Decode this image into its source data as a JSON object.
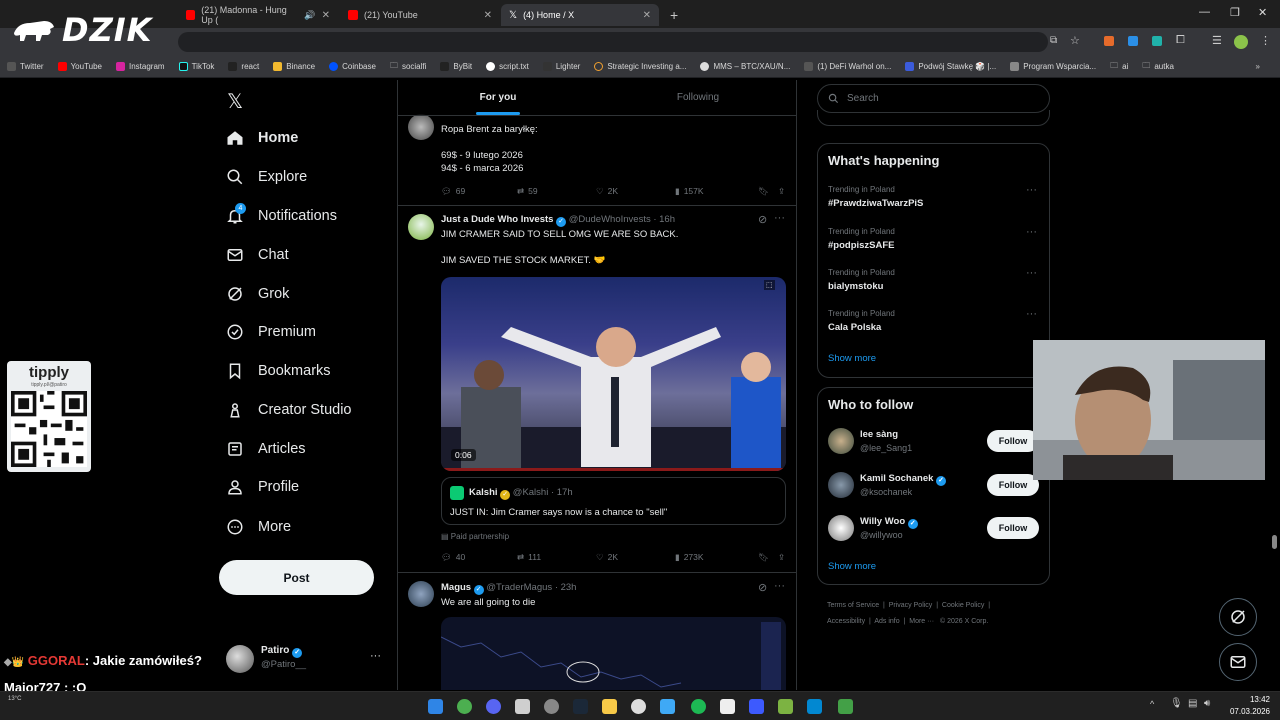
{
  "browser": {
    "tabs": [
      {
        "label": "(21) Madonna - Hung Up (",
        "icon": "youtube-icon",
        "color": "#ff0000"
      },
      {
        "label": "(21) YouTube",
        "icon": "youtube-icon",
        "color": "#ff0000"
      },
      {
        "label": "(4) Home / X",
        "icon": "x-icon",
        "color": "#ffffff",
        "active": true
      }
    ],
    "new_tab": "+",
    "bookmarks": [
      "Twitter",
      "YouTube",
      "Instagram",
      "TikTok",
      "react",
      "Binance",
      "Coinbase",
      "socialfi",
      "ByBit",
      "script.txt",
      "Lighter",
      "Strategic Investing a...",
      "MMS – BTC/XAU/N...",
      "(1) DeFi Warhol on...",
      "Podwój Stawkę 🎲 |...",
      "Program Wsparcia...",
      "ai",
      "autka"
    ]
  },
  "overlay": {
    "logo_text": "DZIK",
    "tipply_title": "tipply",
    "tipply_url": "tipply.pl/@patiro",
    "chat_user": "GGORAL",
    "chat_msg": ": Jakie zamówiłeś?",
    "chat_line2": "Major727 : :O",
    "weather": "13°C"
  },
  "nav": {
    "items": [
      {
        "label": "Home",
        "icon": "home-icon"
      },
      {
        "label": "Explore",
        "icon": "search-icon"
      },
      {
        "label": "Notifications",
        "icon": "bell-icon",
        "badge": "4"
      },
      {
        "label": "Chat",
        "icon": "mail-icon"
      },
      {
        "label": "Grok",
        "icon": "grok-icon"
      },
      {
        "label": "Premium",
        "icon": "premium-icon"
      },
      {
        "label": "Bookmarks",
        "icon": "bookmark-icon"
      },
      {
        "label": "Creator Studio",
        "icon": "creator-studio-icon"
      },
      {
        "label": "Articles",
        "icon": "articles-icon"
      },
      {
        "label": "Profile",
        "icon": "profile-icon"
      },
      {
        "label": "More",
        "icon": "more-icon"
      }
    ],
    "post_label": "Post",
    "account_name": "Patiro",
    "account_handle": "@Patiro__"
  },
  "feed": {
    "tabs": [
      "For you",
      "Following"
    ],
    "tweets": [
      {
        "text_lines": [
          "Ropa Brent za baryłkę:",
          "",
          "69$ - 9 lutego 2026",
          "94$ - 6 marca 2026"
        ],
        "replies": "69",
        "reposts": "59",
        "likes": "2K",
        "views": "157K"
      },
      {
        "name": "Just a Dude Who Invests",
        "handle": "@DudeWhoInvests",
        "time": "· 16h",
        "text_lines": [
          "JIM CRAMER SAID TO SELL OMG WE ARE SO BACK.",
          "",
          "JIM SAVED THE STOCK MARKET. 🤝"
        ],
        "video_time": "0:06",
        "quote_name": "Kalshi",
        "quote_handle": "@Kalshi",
        "quote_time": "· 17h",
        "quote_text": "JUST IN: Jim Cramer says now is a chance to \"sell\"",
        "paid": "Paid partnership",
        "replies": "40",
        "reposts": "111",
        "likes": "2K",
        "views": "273K"
      },
      {
        "name": "Magus",
        "handle": "@TraderMagus",
        "time": "· 23h",
        "text_lines": [
          "We are all going to die"
        ]
      }
    ]
  },
  "right": {
    "search_placeholder": "Search",
    "happening_title": "What's happening",
    "trends": [
      {
        "meta": "Trending in Poland",
        "name": "#PrawdziwaTwarzPiS"
      },
      {
        "meta": "Trending in Poland",
        "name": "#podpiszSAFE"
      },
      {
        "meta": "Trending in Poland",
        "name": "bialymstoku"
      },
      {
        "meta": "Trending in Poland",
        "name": "Cala Polska"
      }
    ],
    "show_more": "Show more",
    "wtf_title": "Who to follow",
    "who_to_follow": [
      {
        "name": "lee sàng",
        "handle": "@lee_Sang1",
        "verified": false
      },
      {
        "name": "Kamil Sochanek",
        "handle": "@ksochanek",
        "verified": true
      },
      {
        "name": "Willy Woo",
        "handle": "@willywoo",
        "verified": true
      }
    ],
    "follow_label": "Follow",
    "footer": [
      "Terms of Service",
      "Privacy Policy",
      "Cookie Policy",
      "Accessibility",
      "Ads info",
      "More ···",
      "© 2026 X Corp."
    ]
  },
  "system": {
    "time": "13:42",
    "date": "07.03.2026"
  }
}
